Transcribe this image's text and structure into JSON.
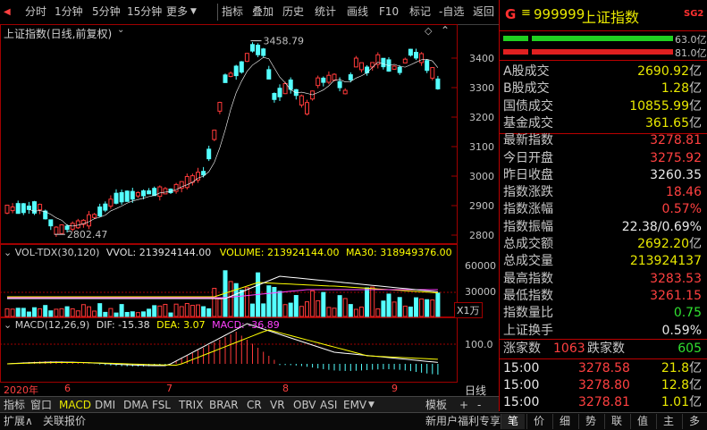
{
  "toolbar": {
    "items": [
      "分时",
      "1分钟",
      "5分钟",
      "15分钟",
      "更多"
    ],
    "right_items": [
      "指标",
      "叠加",
      "历史",
      "统计",
      "画线",
      "F10",
      "标记",
      "-自选",
      "返回"
    ]
  },
  "chart": {
    "title": "上证指数(日线,前复权)",
    "high_label": "3458.79",
    "low_label": "2802.47",
    "price_ticks": [
      "3400",
      "3300",
      "3200",
      "3100",
      "3000",
      "2900",
      "2800"
    ],
    "vol_title": "VOL-TDX(30,120)",
    "vol_vol": "VVOL: 213924144.00",
    "vol_volume": "VOLUME: 213924144.00",
    "vol_ma30": "MA30: 318949376.00",
    "vol_ticks": [
      "60000",
      "30000"
    ],
    "vol_unit": "X1万",
    "macd_title": "MACD(12,26,9)",
    "macd_dif": "DIF: -15.38",
    "macd_dea": "DEA: 3.07",
    "macd_macd": "MACD: -36.89",
    "macd_tick": "100.0",
    "dates": [
      "2020年",
      "6",
      "7",
      "8",
      "9"
    ],
    "period": "日线",
    "colors": {
      "up": "#ff3a3a",
      "down": "#54ffff",
      "ma_white": "#ffffff",
      "ma_yellow": "#ffff00",
      "ma_purple": "#ff40ff"
    }
  },
  "right": {
    "code_prefix": "G",
    "code": "999999",
    "name": "上证指数",
    "badge": "SG2",
    "bar1_val": "63.0亿",
    "bar2_val": "81.0亿",
    "rows": [
      {
        "label": "A股成交",
        "value": "2690.92",
        "unit": "亿",
        "color": "yel"
      },
      {
        "label": "B股成交",
        "value": "1.28",
        "unit": "亿",
        "color": "yel"
      },
      {
        "label": "国债成交",
        "value": "10855.99",
        "unit": "亿",
        "color": "yel"
      },
      {
        "label": "基金成交",
        "value": "361.65",
        "unit": "亿",
        "color": "yel"
      },
      {
        "label": "最新指数",
        "value": "3278.81",
        "unit": "",
        "color": "red"
      },
      {
        "label": "今日开盘",
        "value": "3275.92",
        "unit": "",
        "color": "red"
      },
      {
        "label": "昨日收盘",
        "value": "3260.35",
        "unit": "",
        "color": "wht"
      },
      {
        "label": "指数涨跌",
        "value": "18.46",
        "unit": "",
        "color": "red"
      },
      {
        "label": "指数涨幅",
        "value": "0.57%",
        "unit": "",
        "color": "red"
      },
      {
        "label": "指数振幅",
        "value": "22.38/0.69%",
        "unit": "",
        "color": "wht"
      },
      {
        "label": "总成交额",
        "value": "2692.20",
        "unit": "亿",
        "color": "yel"
      },
      {
        "label": "总成交量",
        "value": "213924137",
        "unit": "",
        "color": "yel"
      },
      {
        "label": "最高指数",
        "value": "3283.53",
        "unit": "",
        "color": "red"
      },
      {
        "label": "最低指数",
        "value": "3261.15",
        "unit": "",
        "color": "red"
      },
      {
        "label": "指数量比",
        "value": "0.75",
        "unit": "",
        "color": "grn"
      },
      {
        "label": "上证换手",
        "value": "0.59%",
        "unit": "",
        "color": "wht"
      }
    ],
    "rise_label": "涨家数",
    "rise_value": "1063",
    "fall_label": "跌家数",
    "fall_value": "605",
    "ticks": [
      {
        "time": "15:00",
        "price": "3278.58",
        "vol": "21.8",
        "unit": "亿"
      },
      {
        "time": "15:00",
        "price": "3278.80",
        "vol": "12.8",
        "unit": "亿"
      },
      {
        "time": "15:00",
        "price": "3278.81",
        "vol": "1.01",
        "unit": "亿"
      }
    ]
  },
  "tabs": [
    "指标",
    "窗口",
    "MACD",
    "DMI",
    "DMA",
    "FSL",
    "TRIX",
    "BRAR",
    "CR",
    "VR",
    "OBV",
    "ASI",
    "EMV",
    "模板",
    "+",
    "-"
  ],
  "status": {
    "left": [
      "扩展∧",
      "关联报价"
    ],
    "promo": "新用户福利专享",
    "right_tabs": [
      "笔",
      "价",
      "细",
      "势",
      "联",
      "值",
      "主",
      "多"
    ]
  }
}
